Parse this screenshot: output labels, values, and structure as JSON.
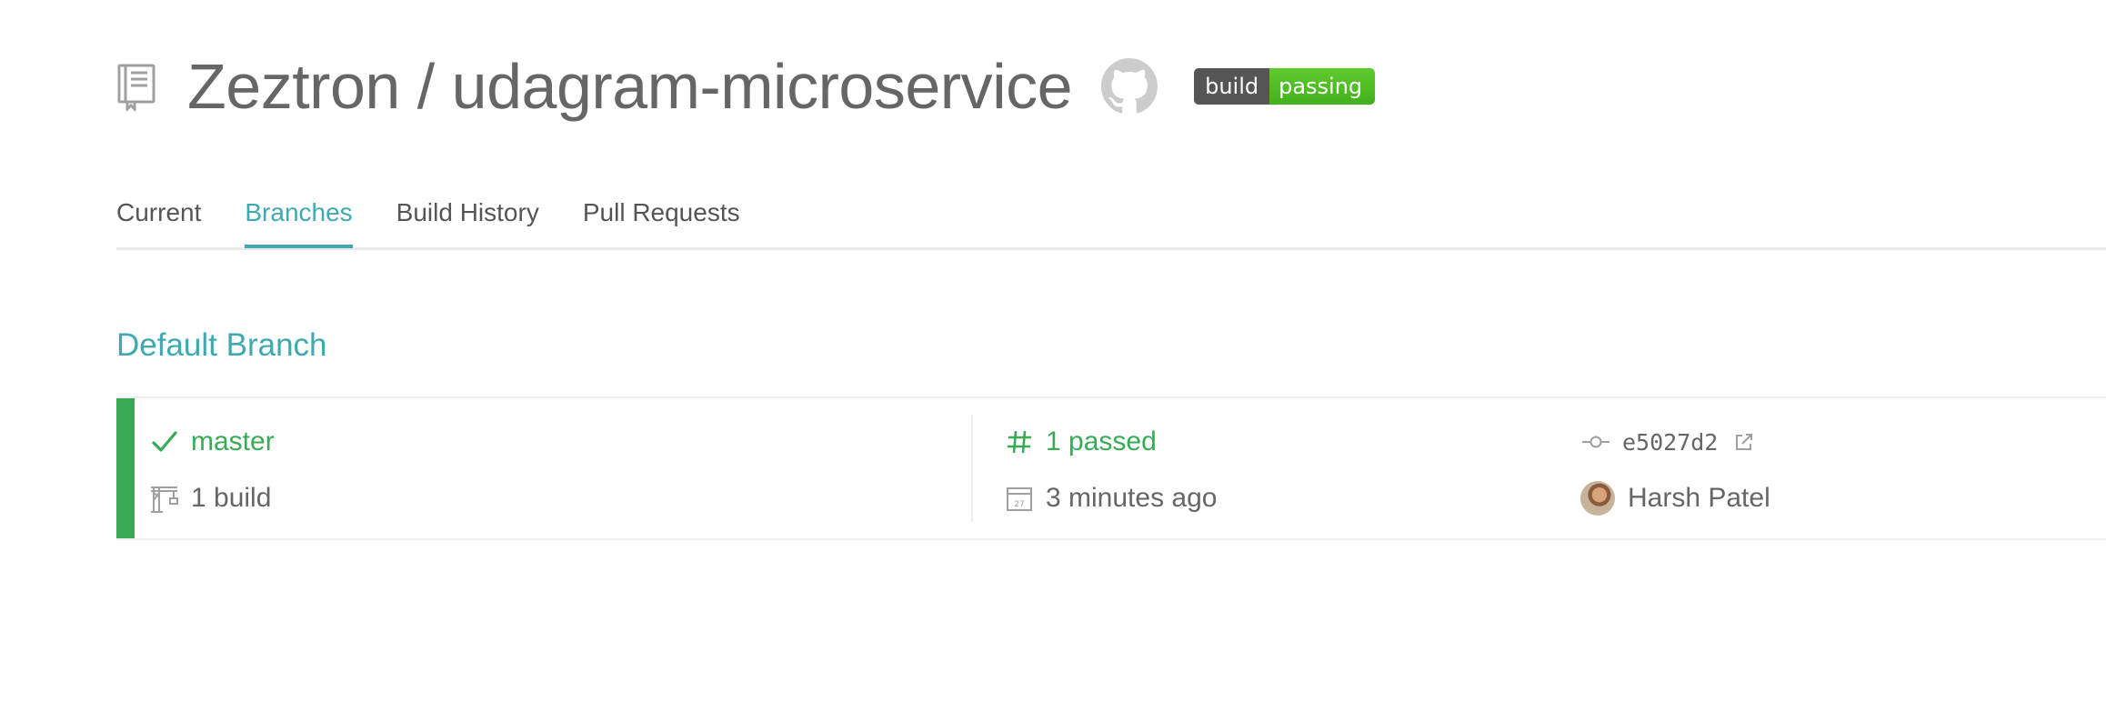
{
  "header": {
    "owner": "Zeztron",
    "separator": "/",
    "repo": "udagram-microservice",
    "title": "Zeztron / udagram-microservice",
    "badge": {
      "left": "build",
      "right": "passing"
    }
  },
  "tabs": [
    {
      "label": "Current",
      "active": false
    },
    {
      "label": "Branches",
      "active": true
    },
    {
      "label": "Build History",
      "active": false
    },
    {
      "label": "Pull Requests",
      "active": false
    }
  ],
  "section": {
    "title": "Default Branch"
  },
  "branch": {
    "name": "master",
    "builds": "1 build",
    "build_status": "1 passed",
    "time": "3 minutes ago",
    "commit": "e5027d2",
    "author": "Harsh Patel",
    "status_color": "#39aa56"
  },
  "colors": {
    "accent": "#3eaaaf",
    "passed": "#39aa56",
    "text": "#666666"
  },
  "icons": {
    "repo": "repo-book-icon",
    "github": "github-octocat-icon",
    "branch_status": "checkmark-icon",
    "builds": "crane-icon",
    "build_number": "hash-icon",
    "calendar": "calendar-icon",
    "commit": "commit-icon",
    "external": "external-link-icon"
  }
}
